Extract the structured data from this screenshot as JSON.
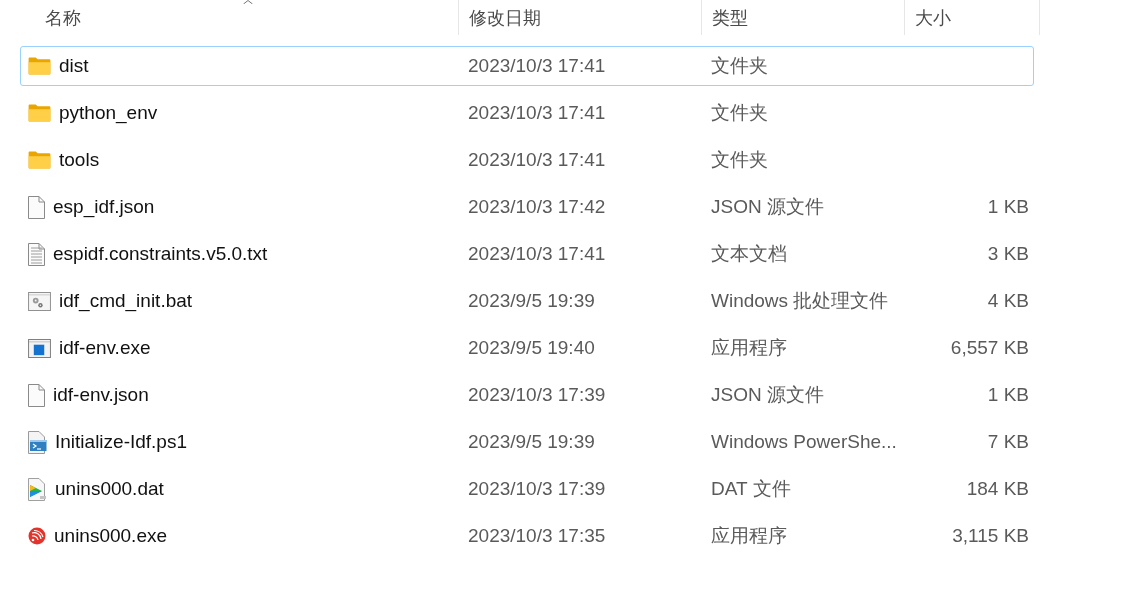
{
  "columns": [
    {
      "label": "名称",
      "sorted": true
    },
    {
      "label": "修改日期",
      "sorted": false
    },
    {
      "label": "类型",
      "sorted": false
    },
    {
      "label": "大小",
      "sorted": false
    }
  ],
  "rows": [
    {
      "kind": "folder",
      "name": "dist",
      "date": "2023/10/3 17:41",
      "type": "文件夹",
      "selected": true
    },
    {
      "kind": "folder",
      "name": "python_env",
      "date": "2023/10/3 17:41",
      "type": "文件夹",
      "selected": false
    },
    {
      "kind": "folder",
      "name": "tools",
      "date": "2023/10/3 17:41",
      "type": "文件夹",
      "selected": false
    },
    {
      "kind": "blank",
      "name": "esp_idf.json",
      "date": "2023/10/3 17:42",
      "type": "JSON 源文件",
      "size": "1 KB",
      "selected": false
    },
    {
      "kind": "text",
      "name": "espidf.constraints.v5.0.txt",
      "date": "2023/10/3 17:41",
      "type": "文本文档",
      "size": "3 KB",
      "selected": false
    },
    {
      "kind": "batch",
      "name": "idf_cmd_init.bat",
      "date": "2023/9/5 19:39",
      "type": "Windows 批处理文件",
      "size": "4 KB",
      "selected": false
    },
    {
      "kind": "exe",
      "name": "idf-env.exe",
      "date": "2023/9/5 19:40",
      "type": "应用程序",
      "size": "6,557 KB",
      "selected": false
    },
    {
      "kind": "blank",
      "name": "idf-env.json",
      "date": "2023/10/3 17:39",
      "type": "JSON 源文件",
      "size": "1 KB",
      "selected": false
    },
    {
      "kind": "powershell",
      "name": "Initialize-Idf.ps1",
      "date": "2023/9/5 19:39",
      "type": "Windows PowerShe...",
      "size": "7 KB",
      "selected": false
    },
    {
      "kind": "video",
      "name": "unins000.dat",
      "date": "2023/10/3 17:39",
      "type": "DAT 文件",
      "size": "184 KB",
      "selected": false
    },
    {
      "kind": "logo",
      "name": "unins000.exe",
      "date": "2023/10/3 17:35",
      "type": "应用程序",
      "size": "3,115 KB",
      "selected": false
    }
  ]
}
